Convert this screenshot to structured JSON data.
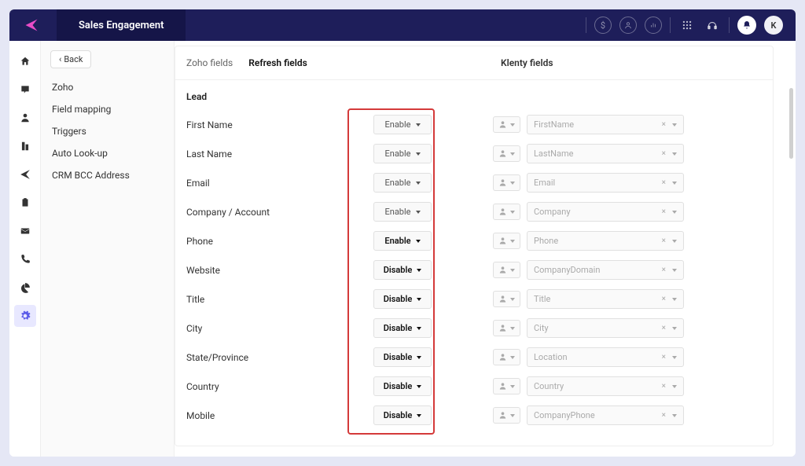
{
  "header": {
    "title": "Sales Engagement",
    "avatar_letter": "K"
  },
  "sidebar": {
    "back_label": "Back",
    "items": [
      {
        "label": "Zoho"
      },
      {
        "label": "Field mapping"
      },
      {
        "label": "Triggers"
      },
      {
        "label": "Auto Look-up"
      },
      {
        "label": "CRM BCC Address"
      }
    ]
  },
  "tabs": {
    "zoho_fields": "Zoho fields",
    "refresh_fields": "Refresh fields",
    "klenty_fields": "Klenty fields"
  },
  "section": {
    "title": "Lead"
  },
  "fields": [
    {
      "label": "First Name",
      "toggle": "Enable",
      "strong": false,
      "klenty": "FirstName"
    },
    {
      "label": "Last Name",
      "toggle": "Enable",
      "strong": false,
      "klenty": "LastName"
    },
    {
      "label": "Email",
      "toggle": "Enable",
      "strong": false,
      "klenty": "Email"
    },
    {
      "label": "Company / Account",
      "toggle": "Enable",
      "strong": false,
      "klenty": "Company"
    },
    {
      "label": "Phone",
      "toggle": "Enable",
      "strong": true,
      "klenty": "Phone"
    },
    {
      "label": "Website",
      "toggle": "Disable",
      "strong": true,
      "klenty": "CompanyDomain"
    },
    {
      "label": "Title",
      "toggle": "Disable",
      "strong": true,
      "klenty": "Title"
    },
    {
      "label": "City",
      "toggle": "Disable",
      "strong": true,
      "klenty": "City"
    },
    {
      "label": "State/Province",
      "toggle": "Disable",
      "strong": true,
      "klenty": "Location"
    },
    {
      "label": "Country",
      "toggle": "Disable",
      "strong": true,
      "klenty": "Country"
    },
    {
      "label": "Mobile",
      "toggle": "Disable",
      "strong": true,
      "klenty": "CompanyPhone"
    }
  ]
}
